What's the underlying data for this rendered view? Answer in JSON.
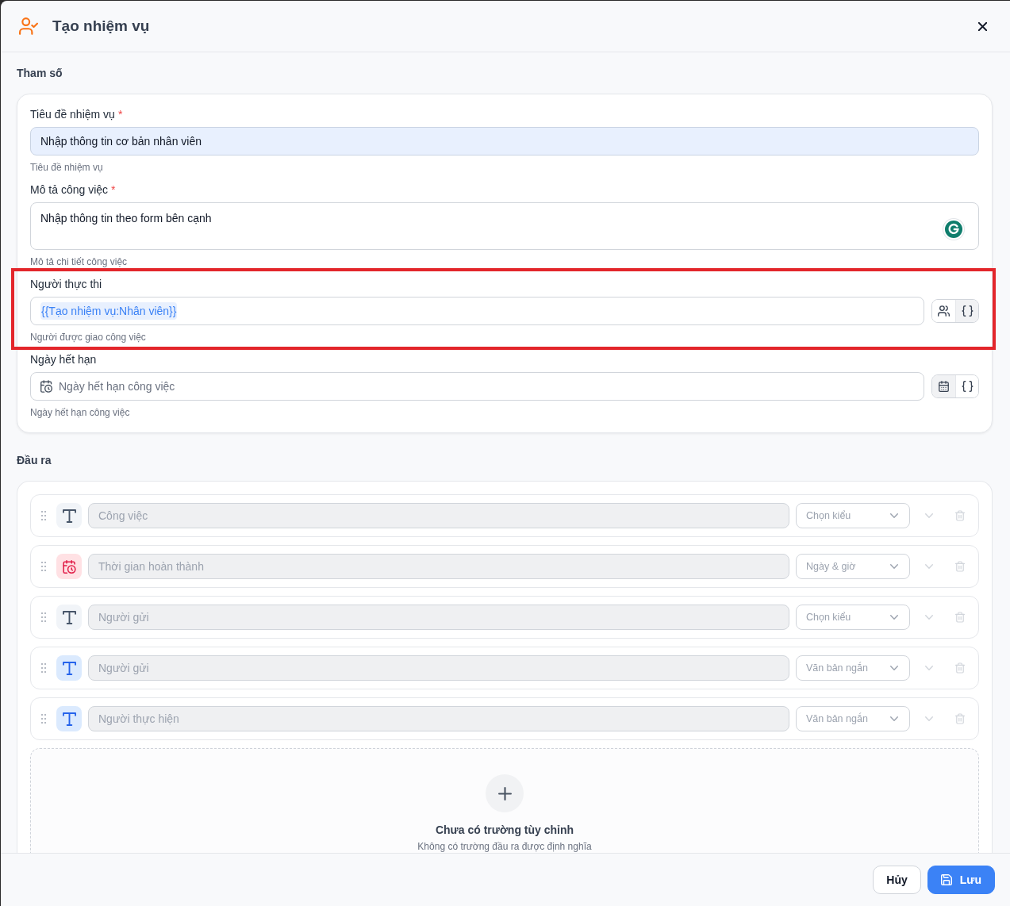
{
  "dialog": {
    "title": "Tạo nhiệm vụ"
  },
  "parameters": {
    "heading": "Tham số",
    "fields": [
      {
        "kind": "text",
        "label": "Tiêu đề nhiệm vụ",
        "required_mark": "*",
        "value": "Nhập thông tin cơ bản nhân viên",
        "autofilled": true,
        "highlighted": false,
        "help": "Tiêu đề nhiệm vụ"
      },
      {
        "kind": "textarea",
        "label": "Mô tả công việc",
        "required_mark": "*",
        "value": "Nhập thông tin theo form bên cạnh",
        "autofilled": false,
        "highlighted": false,
        "help": "Mô tả chi tiết công việc"
      },
      {
        "kind": "assignee",
        "label": "Người thực thi",
        "token": "{{Tạo nhiệm vụ:Nhân viên}}",
        "autofilled": false,
        "variable_mode": true,
        "highlighted": true,
        "help": "Người được giao công việc"
      },
      {
        "kind": "date",
        "label": "Ngày hết hạn",
        "placeholder": "Ngày hết hạn công việc",
        "autofilled": false,
        "variable_mode": false,
        "highlighted": false,
        "help": "Ngày hết hạn công việc"
      }
    ]
  },
  "outputs": {
    "heading": "Đầu ra",
    "rows": [
      {
        "kind": "untyped",
        "name": "Công việc",
        "type_placeholder": "Chọn kiểu",
        "disabled": true
      },
      {
        "kind": "datetime",
        "name": "Thời gian hoàn thành",
        "type": "Ngày & giờ",
        "disabled": true
      },
      {
        "kind": "untyped",
        "name": "Người gửi",
        "type_placeholder": "Chọn kiểu",
        "disabled": true
      },
      {
        "kind": "text",
        "name": "Người gửi",
        "type": "Văn bản ngắn",
        "disabled": true
      },
      {
        "kind": "text",
        "name": "Người thực hiện",
        "type": "Văn bản ngắn",
        "disabled": true
      }
    ],
    "empty_state": {
      "title": "Chưa có trường tùy chỉnh",
      "subtitle": "Không có trường đầu ra được định nghĩa"
    }
  },
  "footer": {
    "buttons": [
      {
        "kind": "secondary",
        "label": "Hủy"
      },
      {
        "kind": "primary",
        "label": "Lưu"
      }
    ]
  }
}
